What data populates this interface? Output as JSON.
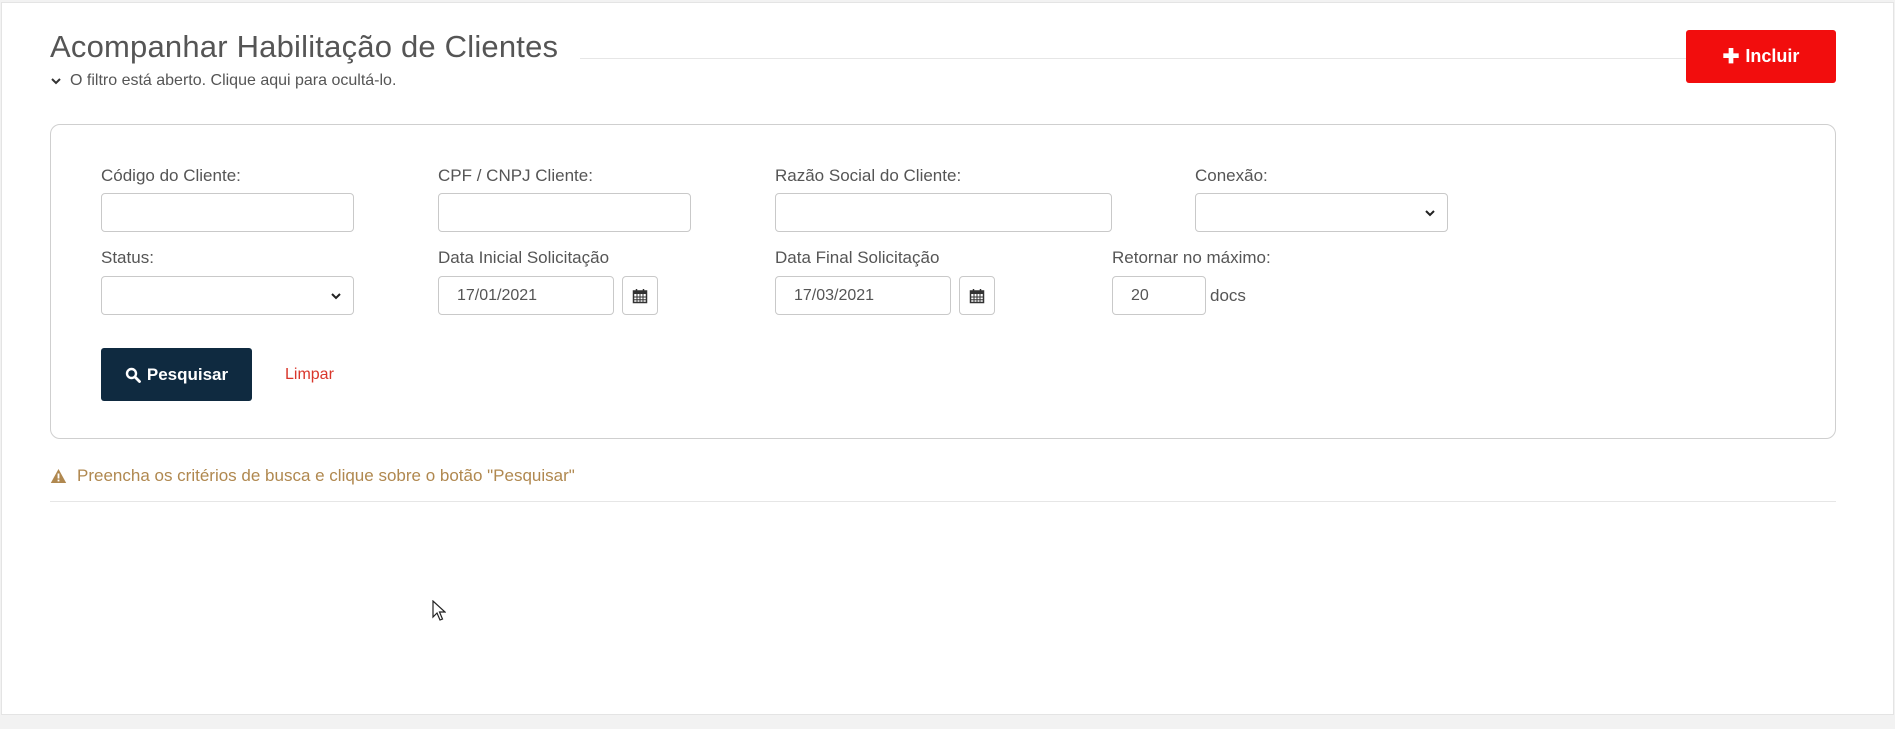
{
  "header": {
    "title": "Acompanhar Habilitação de Clientes",
    "filter_toggle": "O filtro está aberto. Clique aqui para ocultá-lo.",
    "include_button": "Incluir"
  },
  "filters": {
    "codigo_cliente": {
      "label": "Código do Cliente:",
      "value": ""
    },
    "cpf_cnpj": {
      "label": "CPF / CNPJ Cliente:",
      "value": ""
    },
    "razao_social": {
      "label": "Razão Social do Cliente:",
      "value": ""
    },
    "conexao": {
      "label": "Conexão:",
      "selected": ""
    },
    "status": {
      "label": "Status:",
      "selected": ""
    },
    "data_inicial": {
      "label": "Data Inicial Solicitação",
      "value": "17/01/2021"
    },
    "data_final": {
      "label": "Data Final Solicitação",
      "value": "17/03/2021"
    },
    "max_results": {
      "label": "Retornar no máximo:",
      "value": "20",
      "unit": "docs"
    }
  },
  "actions": {
    "search_button": "Pesquisar",
    "clear_link": "Limpar"
  },
  "message": {
    "warning": "Preencha os critérios de busca e clique sobre o botão \"Pesquisar\""
  },
  "colors": {
    "include_button": "#f20d0d",
    "search_button": "#0f2a40",
    "clear_link": "#d9362b",
    "warning_text": "#b0884f"
  },
  "icons": [
    "chevron-down-icon",
    "plus-icon",
    "calendar-icon",
    "search-icon",
    "warning-icon",
    "mouse-cursor-icon"
  ]
}
